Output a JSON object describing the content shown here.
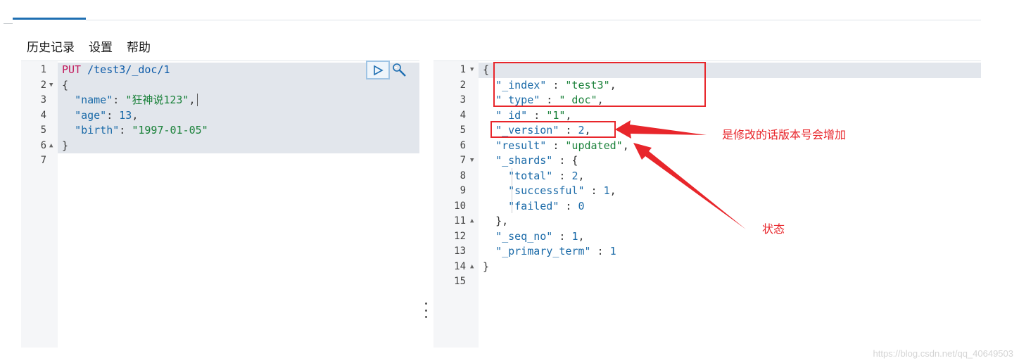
{
  "menu": {
    "history": "历史记录",
    "settings": "设置",
    "help": "帮助"
  },
  "request_editor": {
    "line_numbers": [
      "1",
      "2",
      "3",
      "4",
      "5",
      "6",
      "7"
    ],
    "method": "PUT",
    "path": "/test3/_doc/1",
    "lines": [
      {
        "k": "",
        "v": ""
      },
      {
        "punct": "{"
      },
      {
        "key": "\"name\"",
        "sep": ": ",
        "val": "\"狂神说123\"",
        "end": ","
      },
      {
        "key": "\"age\"",
        "sep": ": ",
        "val": "13",
        "end": ","
      },
      {
        "key": "\"birth\"",
        "sep": ": ",
        "val": "\"1997-01-05\"",
        "end": ""
      },
      {
        "punct": "}"
      }
    ]
  },
  "response_editor": {
    "line_numbers": [
      "1",
      "2",
      "3",
      "4",
      "5",
      "6",
      "7",
      "8",
      "9",
      "10",
      "11",
      "12",
      "13",
      "14",
      "15"
    ],
    "brace_open": "{",
    "brace_close": "}",
    "index_key": "\"_index\"",
    "index_val": "\"test3\"",
    "type_key": "\"_type\"",
    "type_val": "\"_doc\"",
    "id_key": "\"_id\"",
    "id_val": "\"1\"",
    "version_key": "\"_version\"",
    "version_val": "2",
    "result_key": "\"result\"",
    "result_val": "\"updated\"",
    "shards_key": "\"_shards\"",
    "total_key": "\"total\"",
    "total_val": "2",
    "successful_key": "\"successful\"",
    "successful_val": "1",
    "failed_key": "\"failed\"",
    "failed_val": "0",
    "shards_close": "},",
    "seq_key": "\"_seq_no\"",
    "seq_val": "1",
    "term_key": "\"_primary_term\"",
    "term_val": "1"
  },
  "annotations": {
    "version_note": "是修改的话版本号会增加",
    "status_note": "状态",
    "color": "#e8262b"
  },
  "icons": {
    "run": "play-icon",
    "settings": "wrench-icon"
  },
  "watermark": "https://blog.csdn.net/qq_40649503"
}
